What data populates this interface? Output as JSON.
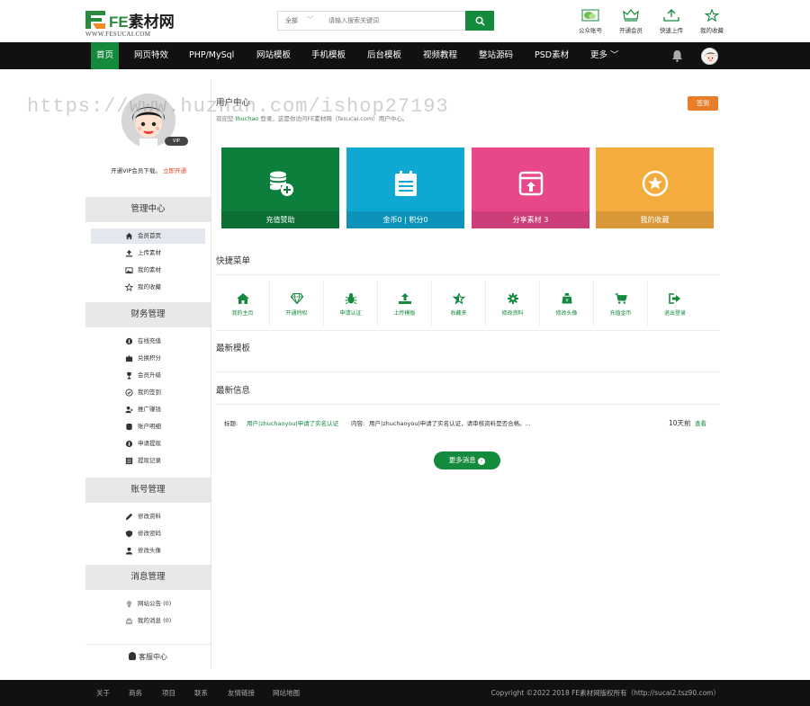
{
  "logo": {
    "brand_fe": "FE",
    "brand_cn": "素材网",
    "url": "WWW.FESUCAI.COM"
  },
  "search": {
    "category": "全部",
    "placeholder": "请输入搜索关键词"
  },
  "header_icons": [
    {
      "label": "公众账号",
      "icon": "wechat-icon"
    },
    {
      "label": "开通会员",
      "icon": "crown-icon"
    },
    {
      "label": "快速上传",
      "icon": "upload-icon"
    },
    {
      "label": "我的收藏",
      "icon": "star-icon"
    }
  ],
  "nav": [
    "首页",
    "网页特效",
    "PHP/MySql",
    "网站模板",
    "手机模板",
    "后台模板",
    "视频教程",
    "整站源码",
    "PSD素材",
    "更多"
  ],
  "sidebar": {
    "vip_text": "开通VIP会员下载。",
    "vip_link": "立即开通",
    "vip_badge": "VIP",
    "sections": [
      {
        "title": "管理中心",
        "items": [
          "会员首页",
          "上传素材",
          "我的素材",
          "我的收藏"
        ]
      },
      {
        "title": "财务管理",
        "items": [
          "在线充值",
          "兑换积分",
          "会员升级",
          "我的签到",
          "推广赚钱",
          "账户明细",
          "申请提现",
          "提现记录"
        ]
      },
      {
        "title": "账号管理",
        "items": [
          "修改资料",
          "修改密码",
          "修改头像"
        ]
      },
      {
        "title": "消息管理",
        "items": [
          "网站公告 (0)",
          "我的消息 (0)"
        ]
      }
    ],
    "bottom": "客服中心"
  },
  "main": {
    "title": "用户中心",
    "welcome_prefix": "欢迎您",
    "username": "lhuchao",
    "welcome_suffix": "登录，这是你访问FE素材网（fesucai.com）用户中心。",
    "sign_btn": "签到",
    "cards": [
      {
        "label": "充值赞助",
        "color": "#0d7f3d",
        "icon": "coins-icon"
      },
      {
        "label": "金币0 | 积分0",
        "color": "#0fa8d3",
        "icon": "notepad-icon"
      },
      {
        "label": "分享素材 3",
        "color": "#e8478a",
        "icon": "share-icon"
      },
      {
        "label": "我的收藏",
        "color": "#f5ac3f",
        "icon": "star-circle-icon"
      }
    ],
    "quick_title": "快捷菜单",
    "quick": [
      {
        "label": "我的主页",
        "icon": "home-icon"
      },
      {
        "label": "开通特权",
        "icon": "diamond-icon"
      },
      {
        "label": "申请认证",
        "icon": "bug-icon"
      },
      {
        "label": "上传模板",
        "icon": "upload-icon"
      },
      {
        "label": "收藏夹",
        "icon": "star-half-icon"
      },
      {
        "label": "修改资料",
        "icon": "gear-icon"
      },
      {
        "label": "修改头像",
        "icon": "bag-icon"
      },
      {
        "label": "充值金币",
        "icon": "cart-icon"
      },
      {
        "label": "退出登录",
        "icon": "logout-icon"
      }
    ],
    "templates_title": "最新模板",
    "news_title": "最新信息",
    "news": {
      "prefix": "标题:",
      "title": "用户|zhuchaoyou|申请了实名认证",
      "content_prefix": "内容:",
      "content": "用户|zhuchaoyou|申请了实名认证，请审核资料是否合格。...",
      "time": "10天前",
      "view": "查看"
    },
    "more_btn": "更多消息"
  },
  "footer": {
    "links": [
      "关于",
      "商务",
      "项目",
      "联系",
      "友情链接",
      "网站地图"
    ],
    "copyright": "Copyright ©2022 2018 FE素材网版权所有（http://sucai2.tsz90.com）"
  },
  "watermark": "https://www.huzhan.com/ishop27193",
  "colors": {
    "brand_green": "#148a3c",
    "orange": "#e87e2a",
    "nav_bg": "#111111"
  }
}
